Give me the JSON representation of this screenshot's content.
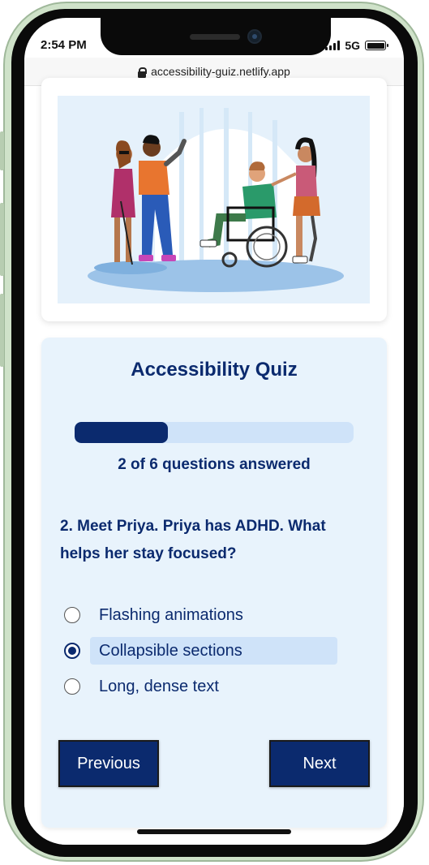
{
  "status": {
    "time": "2:54 PM",
    "network": "5G"
  },
  "browser": {
    "url": "accessibility-guiz.netlify.app"
  },
  "quiz": {
    "title": "Accessibility Quiz",
    "progress": {
      "answered": 2,
      "total": 6,
      "fraction": 0.333,
      "text": "2 of 6 questions answered"
    },
    "question": "2. Meet Priya. Priya has ADHD. What helps her stay focused?",
    "options": [
      {
        "label": "Flashing animations",
        "selected": false
      },
      {
        "label": "Collapsible sections",
        "selected": true
      },
      {
        "label": "Long, dense text",
        "selected": false
      }
    ],
    "buttons": {
      "previous": "Previous",
      "next": "Next"
    }
  },
  "colors": {
    "accent": "#0b2a6e",
    "card_bg": "#e8f3fc",
    "progress_track": "#cfe3f9",
    "phone_frame": "#cfe2c9"
  },
  "icons": {
    "lock": "lock-icon",
    "signal": "signal-icon",
    "battery": "battery-icon"
  }
}
